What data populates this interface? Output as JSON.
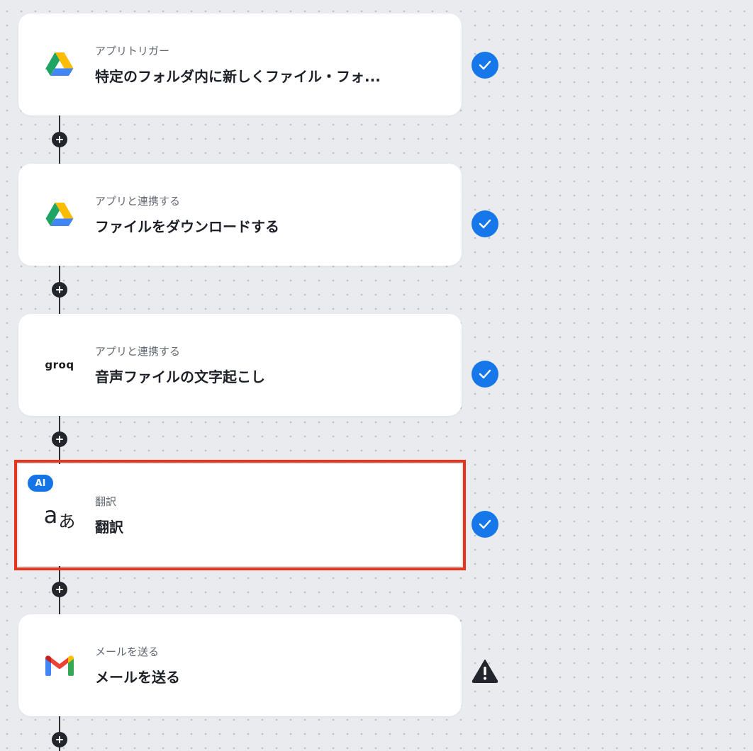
{
  "flow": {
    "steps": [
      {
        "id": "step1",
        "icon": "google-drive-icon",
        "subtitle": "アプリトリガー",
        "title": "特定のフォルダ内に新しくファイル・フォ...",
        "status": "completed",
        "selected": false,
        "ai_badge": false
      },
      {
        "id": "step2",
        "icon": "google-drive-icon",
        "subtitle": "アプリと連携する",
        "title": "ファイルをダウンロードする",
        "status": "completed",
        "selected": false,
        "ai_badge": false
      },
      {
        "id": "step3",
        "icon": "groq-logo",
        "icon_text": "groq",
        "subtitle": "アプリと連携する",
        "title": "音声ファイルの文字起こし",
        "status": "completed",
        "selected": false,
        "ai_badge": false
      },
      {
        "id": "step4",
        "icon": "translate-icon",
        "icon_text_latin": "a",
        "icon_text_kana": "あ",
        "subtitle": "翻訳",
        "title": "翻訳",
        "status": "completed",
        "selected": true,
        "ai_badge": true,
        "badge_label": "AI"
      },
      {
        "id": "step5",
        "icon": "gmail-icon",
        "subtitle": "メールを送る",
        "title": "メールを送る",
        "status": "warning",
        "selected": false,
        "ai_badge": false
      }
    ]
  },
  "colors": {
    "accent_blue": "#1577ea",
    "selection_red": "#e8341c",
    "warning_dark": "#22262c"
  }
}
